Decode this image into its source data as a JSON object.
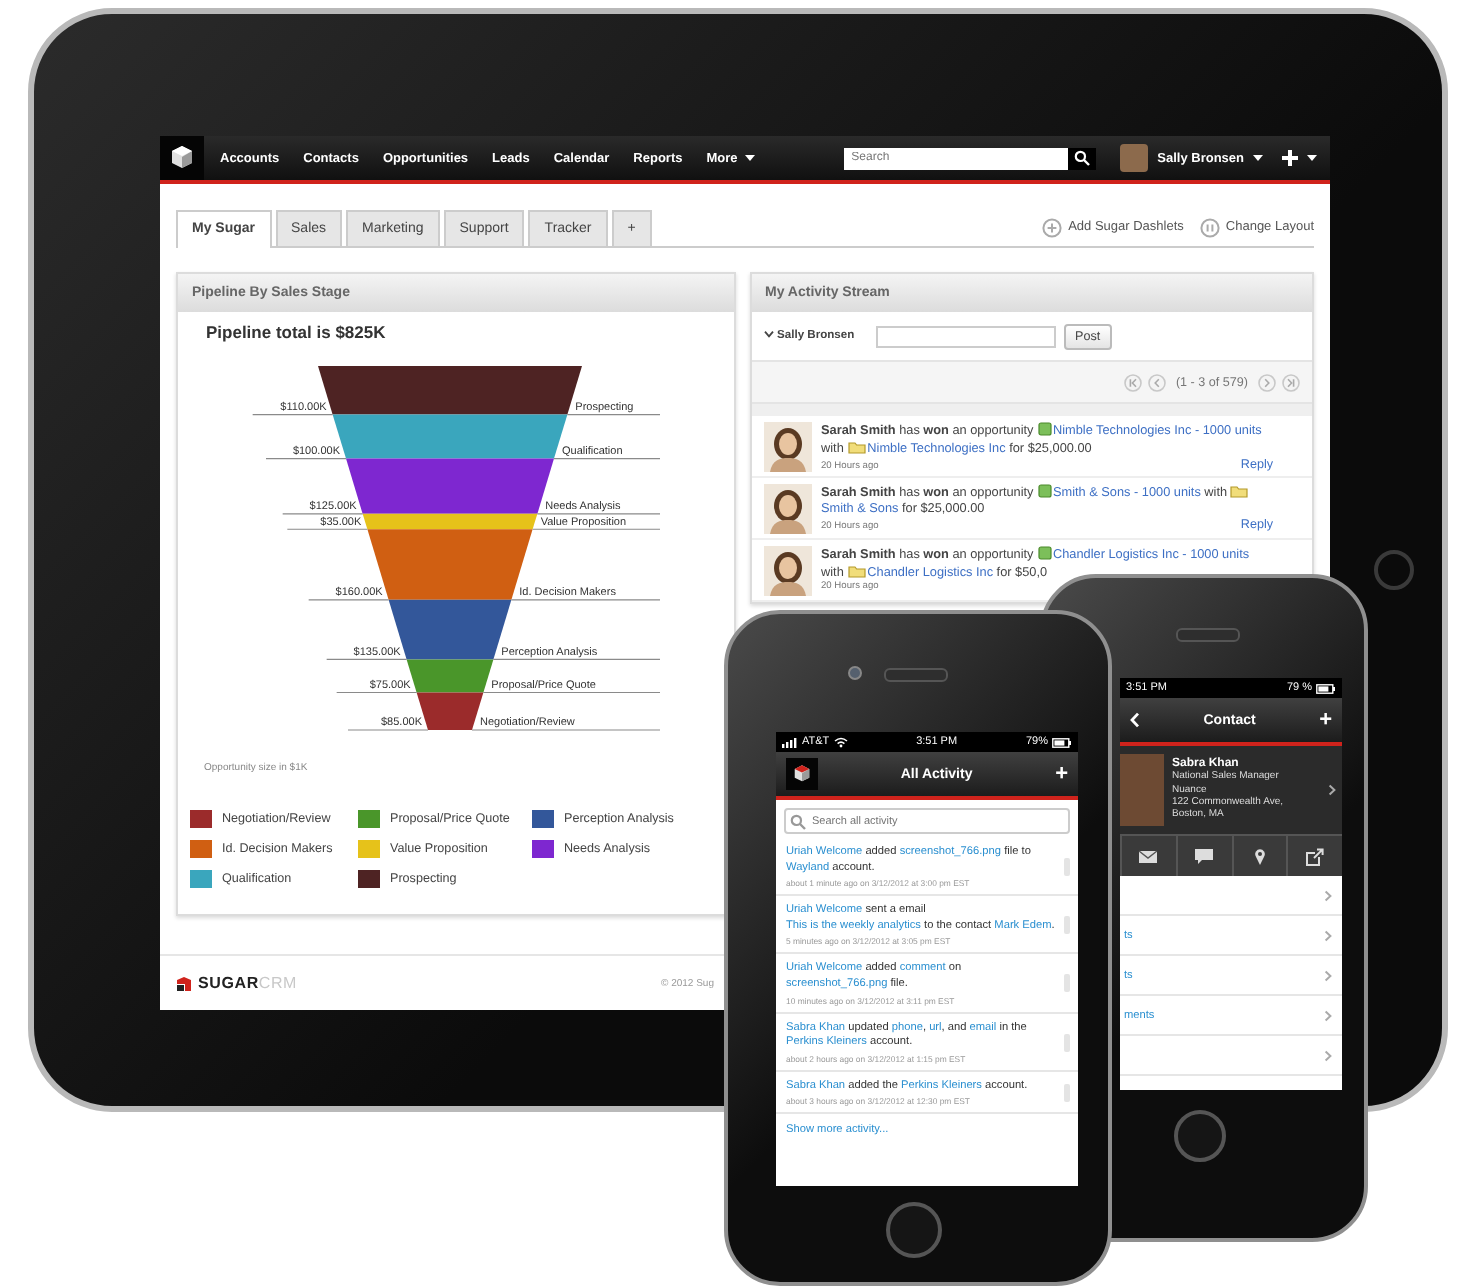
{
  "tablet": {
    "nav": {
      "items": [
        {
          "label": "Accounts",
          "dropdown": false
        },
        {
          "label": "Contacts",
          "dropdown": false
        },
        {
          "label": "Opportunities",
          "dropdown": false
        },
        {
          "label": "Leads",
          "dropdown": false
        },
        {
          "label": "Calendar",
          "dropdown": false
        },
        {
          "label": "Reports",
          "dropdown": false
        },
        {
          "label": "More",
          "dropdown": true
        }
      ],
      "search": {
        "placeholder": "Search"
      },
      "user": "Sally Bronsen"
    },
    "tabs": [
      {
        "label": "My Sugar",
        "selected": true
      },
      {
        "label": "Sales",
        "selected": false
      },
      {
        "label": "Marketing",
        "selected": false
      },
      {
        "label": "Support",
        "selected": false
      },
      {
        "label": "Tracker",
        "selected": false
      },
      {
        "label": "+",
        "selected": false
      }
    ],
    "actions": [
      {
        "kind": "add",
        "label": "Add Sugar Dashlets"
      },
      {
        "kind": "layout",
        "label": "Change Layout"
      }
    ],
    "pipeline": {
      "header": "Pipeline By Sales Stage",
      "title": "Pipeline total is $825K",
      "stages": [
        {
          "stage": "Prospecting",
          "value": "$110.00K",
          "color": "#4e2323"
        },
        {
          "stage": "Qualification",
          "value": "$100.00K",
          "color": "#3aa6bd"
        },
        {
          "stage": "Needs Analysis",
          "value": "$125.00K",
          "color": "#7e27d0"
        },
        {
          "stage": "Value Proposition",
          "value": "$35.00K",
          "color": "#e6c21a"
        },
        {
          "stage": "Id. Decision Makers",
          "value": "$160.00K",
          "color": "#d05f12"
        },
        {
          "stage": "Perception Analysis",
          "value": "$135.00K",
          "color": "#33579a"
        },
        {
          "stage": "Proposal/Price Quote",
          "value": "$75.00K",
          "color": "#4a962a"
        },
        {
          "stage": "Negotiation/Review",
          "value": "$85.00K",
          "color": "#9b2b2b"
        }
      ],
      "note": "Opportunity size in $1K",
      "legend": [
        {
          "label": "Negotiation/Review",
          "color": "#9b2b2b"
        },
        {
          "label": "Proposal/Price Quote",
          "color": "#4a962a"
        },
        {
          "label": "Perception Analysis",
          "color": "#33579a"
        },
        {
          "label": "Id. Decision Makers",
          "color": "#d05f12"
        },
        {
          "label": "Value Proposition",
          "color": "#e6c21a"
        },
        {
          "label": "Needs Analysis",
          "color": "#7e27d0"
        },
        {
          "label": "Qualification",
          "color": "#3aa6bd"
        },
        {
          "label": "Prospecting",
          "color": "#4e2323"
        }
      ]
    },
    "activity": {
      "header": "My Activity Stream",
      "user": "Sally Bronsen",
      "post_button": "Post",
      "pagination": "(1 - 3 of 579)",
      "items": [
        {
          "segments": [
            {
              "kind": "text",
              "text": "**Sarah Smith** has **won** an opportunity "
            },
            {
              "kind": "opportunity_link",
              "text": "Nimble Technologies Inc - 1000 units"
            },
            {
              "kind": "text",
              "text": " with "
            },
            {
              "kind": "account_link",
              "text": "Nimble Technologies Inc"
            },
            {
              "kind": "text",
              "text": " for $25,000.00"
            }
          ],
          "time": "20 Hours ago",
          "reply": "Reply"
        },
        {
          "segments": [
            {
              "kind": "text",
              "text": "**Sarah Smith** has **won** an opportunity "
            },
            {
              "kind": "opportunity_link",
              "text": "Smith & Sons - 1000 units"
            },
            {
              "kind": "text",
              "text": " with "
            },
            {
              "kind": "account_link",
              "text": "Smith & Sons"
            },
            {
              "kind": "text",
              "text": " for $25,000.00"
            }
          ],
          "time": "20 Hours ago",
          "reply": "Reply"
        },
        {
          "segments": [
            {
              "kind": "text",
              "text": "**Sarah Smith** has **won** an opportunity "
            },
            {
              "kind": "opportunity_link",
              "text": "Chandler Logistics Inc - 1000 units"
            },
            {
              "kind": "text",
              "text": " with "
            },
            {
              "kind": "account_link",
              "text": "Chandler Logistics Inc"
            },
            {
              "kind": "text",
              "text": " for $50,0"
            }
          ],
          "time": "20 Hours ago"
        }
      ]
    },
    "footer": {
      "logo": [
        "SUGAR",
        "CRM"
      ],
      "copyright": "© 2012 Sug"
    }
  },
  "activity_phone": {
    "status": {
      "carrier": "AT&T",
      "time": "3:51 PM",
      "battery": "79%"
    },
    "title": "All Activity",
    "add": "+",
    "search": {
      "placeholder": "Search all activity"
    },
    "items": [
      {
        "segments": [
          {
            "kind": "link",
            "text": "Uriah Welcome"
          },
          {
            "kind": "text",
            "text": " added "
          },
          {
            "kind": "link",
            "text": "screenshot_766.png"
          },
          {
            "kind": "text",
            "text": " file to "
          },
          {
            "kind": "link",
            "text": "Wayland"
          },
          {
            "kind": "text",
            "text": " account."
          }
        ],
        "meta": "about 1 minute ago on 3/12/2012 at 3:00 pm EST"
      },
      {
        "segments": [
          {
            "kind": "link",
            "text": "Uriah Welcome"
          },
          {
            "kind": "text",
            "text": " sent a email "
          },
          {
            "kind": "link",
            "text": "This is the weekly analytics"
          },
          {
            "kind": "text",
            "text": " to the contact "
          },
          {
            "kind": "link",
            "text": "Mark Edem"
          },
          {
            "kind": "text",
            "text": "."
          }
        ],
        "meta": "5 minutes ago on 3/12/2012 at 3:05 pm EST"
      },
      {
        "segments": [
          {
            "kind": "link",
            "text": "Uriah Welcome"
          },
          {
            "kind": "text",
            "text": " added "
          },
          {
            "kind": "link",
            "text": "comment"
          },
          {
            "kind": "text",
            "text": " on "
          },
          {
            "kind": "link",
            "text": "screenshot_766.png"
          },
          {
            "kind": "text",
            "text": " file."
          }
        ],
        "meta": "10 minutes ago on 3/12/2012 at 3:11 pm EST"
      },
      {
        "segments": [
          {
            "kind": "link",
            "text": "Sabra Khan"
          },
          {
            "kind": "text",
            "text": " updated "
          },
          {
            "kind": "link",
            "text": "phone"
          },
          {
            "kind": "text",
            "text": ", "
          },
          {
            "kind": "link",
            "text": "url"
          },
          {
            "kind": "text",
            "text": ", and "
          },
          {
            "kind": "link",
            "text": "email"
          },
          {
            "kind": "text",
            "text": " in the "
          },
          {
            "kind": "link",
            "text": "Perkins Kleiners"
          },
          {
            "kind": "text",
            "text": " account."
          }
        ],
        "meta": "about 2 hours ago on 3/12/2012 at 1:15 pm EST"
      },
      {
        "segments": [
          {
            "kind": "link",
            "text": "Sabra Khan"
          },
          {
            "kind": "text",
            "text": " added the "
          },
          {
            "kind": "link",
            "text": "Perkins Kleiners"
          },
          {
            "kind": "text",
            "text": " account."
          }
        ],
        "meta": "about 3 hours ago on 3/12/2012 at 12:30 pm EST"
      }
    ],
    "show_more": "Show more activity..."
  },
  "contact_phone": {
    "status": {
      "time": "3:51 PM",
      "battery": "79 %"
    },
    "title": "Contact",
    "add": "+",
    "contact": {
      "name": "Sabra Khan",
      "lines": [
        "National Sales Manager",
        "Nuance",
        "122 Commonwealth Ave,",
        "Boston, MA"
      ]
    },
    "rows": [
      {
        "kind": "blank"
      },
      {
        "kind": "labeled",
        "label": "ts"
      },
      {
        "kind": "labeled",
        "label": "ts"
      },
      {
        "kind": "labeled",
        "label": "ments"
      },
      {
        "kind": "blank"
      }
    ]
  }
}
